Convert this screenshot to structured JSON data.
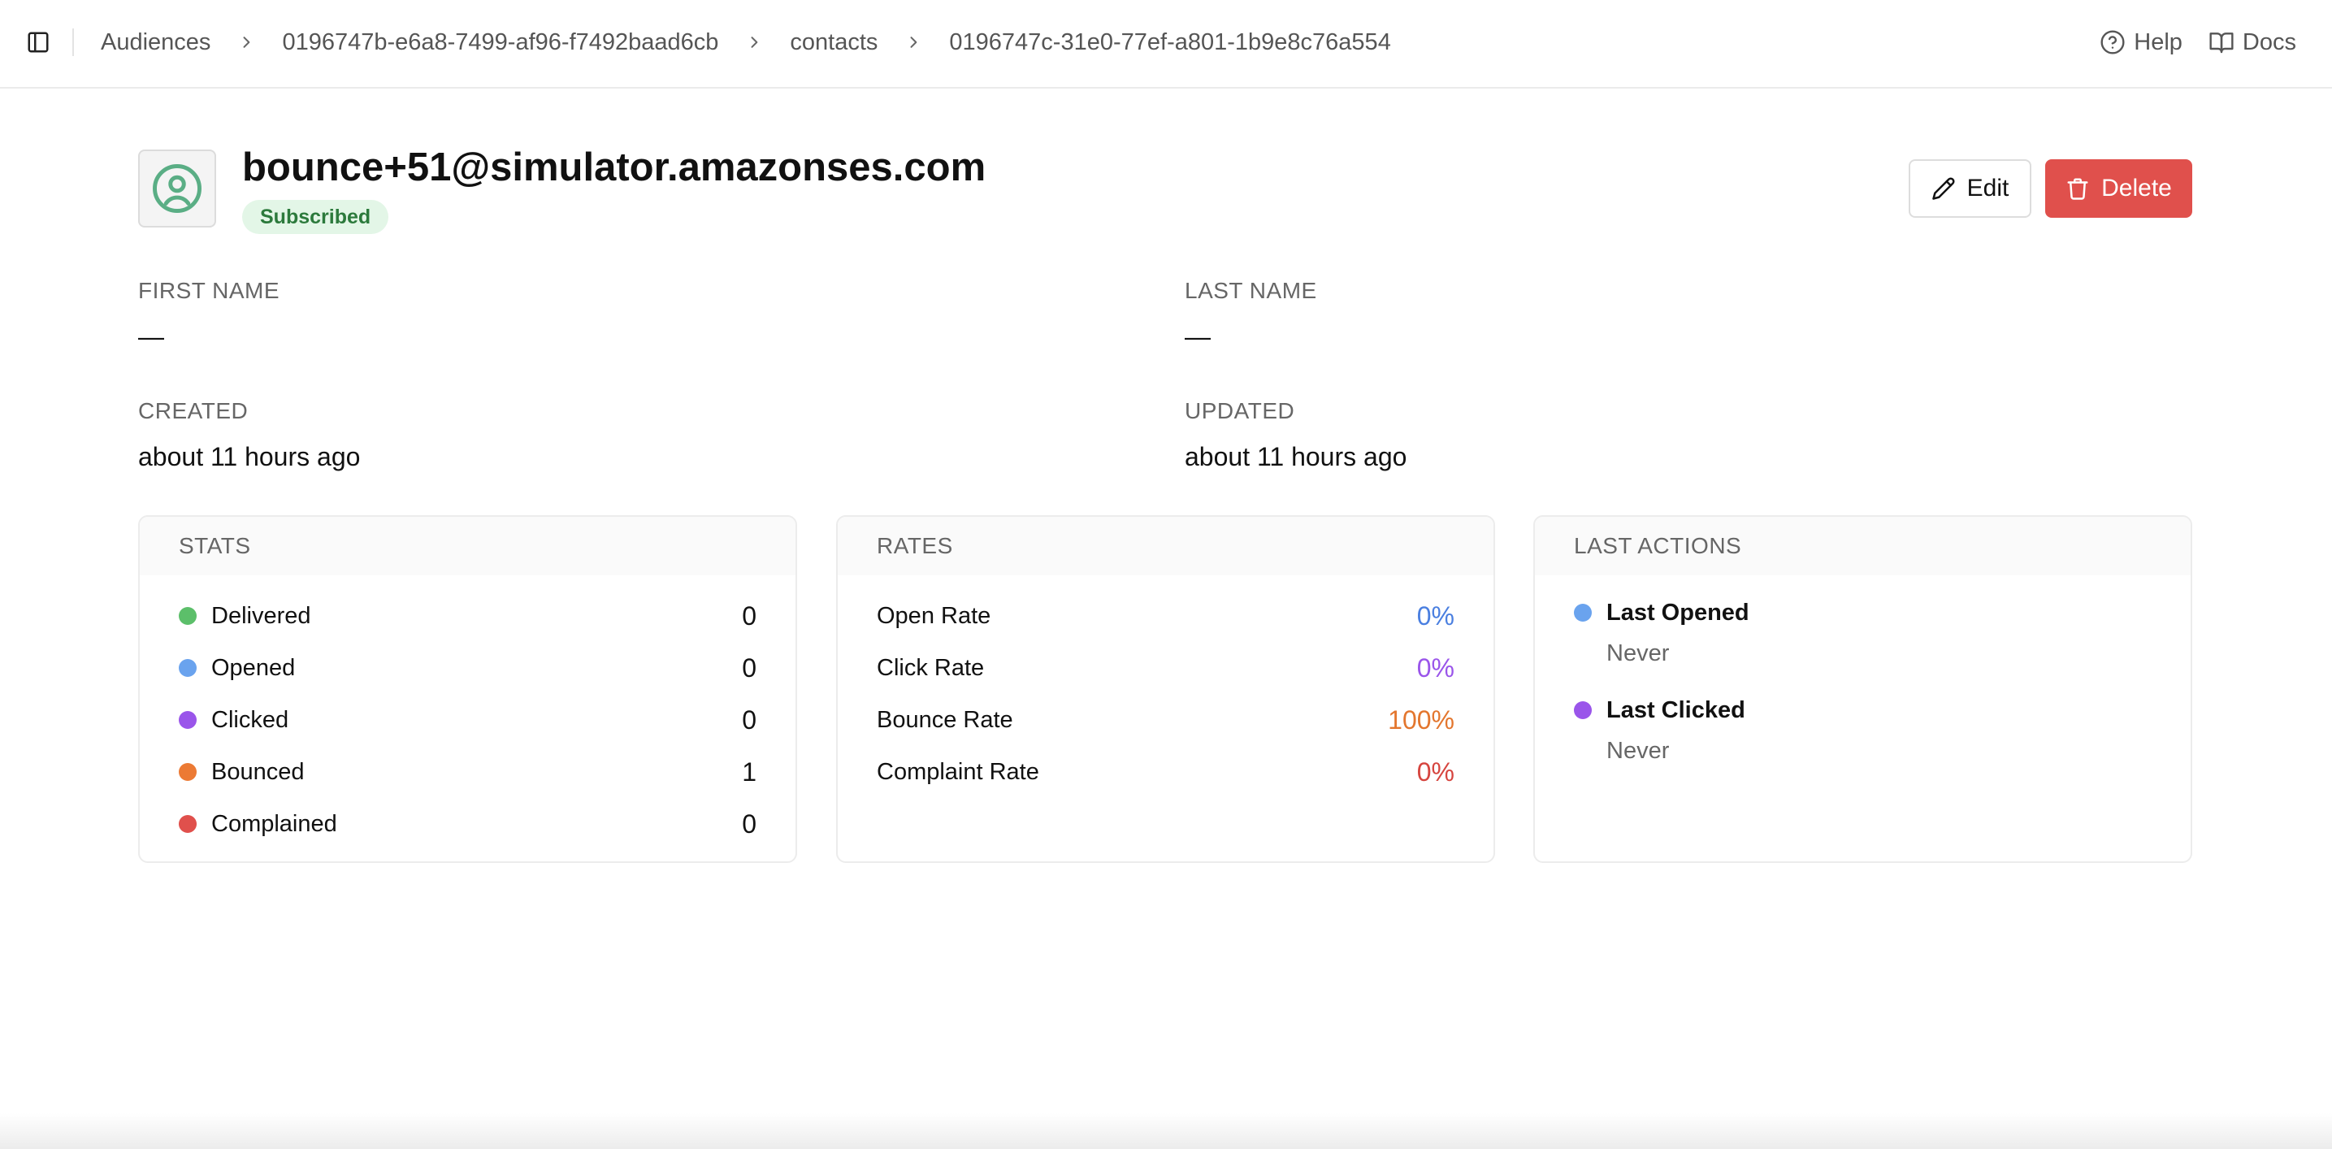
{
  "breadcrumb": {
    "items": [
      "Audiences",
      "0196747b-e6a8-7499-af96-f7492baad6cb",
      "contacts",
      "0196747c-31e0-77ef-a801-1b9e8c76a554"
    ]
  },
  "header_links": {
    "help": "Help",
    "docs": "Docs"
  },
  "contact": {
    "email": "bounce+51@simulator.amazonses.com",
    "status": "Subscribed"
  },
  "actions": {
    "edit": "Edit",
    "delete": "Delete"
  },
  "fields": {
    "first_name": {
      "label": "FIRST NAME",
      "value": "—"
    },
    "last_name": {
      "label": "LAST NAME",
      "value": "—"
    },
    "created": {
      "label": "CREATED",
      "value": "about 11 hours ago"
    },
    "updated": {
      "label": "UPDATED",
      "value": "about 11 hours ago"
    }
  },
  "stats": {
    "title": "STATS",
    "items": [
      {
        "label": "Delivered",
        "value": "0",
        "color": "#5cbf6a"
      },
      {
        "label": "Opened",
        "value": "0",
        "color": "#6aa3ee"
      },
      {
        "label": "Clicked",
        "value": "0",
        "color": "#9a55ea"
      },
      {
        "label": "Bounced",
        "value": "1",
        "color": "#ec7a34"
      },
      {
        "label": "Complained",
        "value": "0",
        "color": "#e0504c"
      }
    ]
  },
  "rates": {
    "title": "RATES",
    "items": [
      {
        "label": "Open Rate",
        "value": "0%",
        "color": "#4a7fe0"
      },
      {
        "label": "Click Rate",
        "value": "0%",
        "color": "#9a55ea"
      },
      {
        "label": "Bounce Rate",
        "value": "100%",
        "color": "#e3762e"
      },
      {
        "label": "Complaint Rate",
        "value": "0%",
        "color": "#d6453f"
      }
    ]
  },
  "last_actions": {
    "title": "LAST ACTIONS",
    "items": [
      {
        "label": "Last Opened",
        "value": "Never",
        "color": "#6aa3ee"
      },
      {
        "label": "Last Clicked",
        "value": "Never",
        "color": "#9a55ea"
      }
    ]
  },
  "colors": {
    "accent_green": "#5aae85",
    "delete_red": "#e0504c",
    "badge_bg": "#e3f6e7",
    "badge_text": "#2c7a3c"
  },
  "icons": {
    "sidebar_toggle": "sidebar-toggle-icon",
    "chevron": "chevron-right-icon",
    "help": "help-circle-icon",
    "docs": "book-open-icon",
    "avatar": "user-circle-icon",
    "edit": "pencil-icon",
    "delete": "trash-icon"
  }
}
